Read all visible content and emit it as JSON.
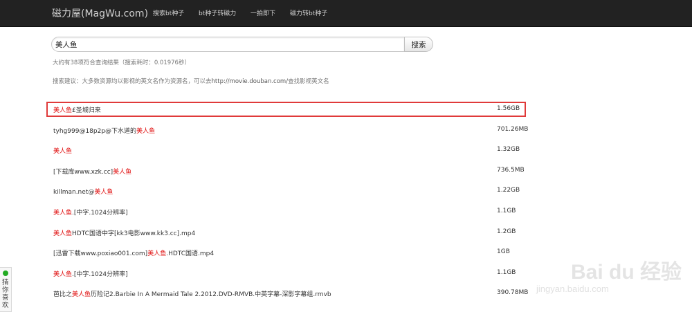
{
  "header": {
    "brand": "磁力屋(MagWu.com)",
    "nav": [
      {
        "label": "搜索bt种子"
      },
      {
        "label": "bt种子转磁力"
      },
      {
        "label": "一拍即下"
      },
      {
        "label": "磁力转bt种子"
      }
    ]
  },
  "search": {
    "query": "美人鱼",
    "button_label": "搜索"
  },
  "meta": {
    "result_count": "大约有38项符合查询结果（搜索耗时：0.01976秒）",
    "suggestion_prefix": "搜索建议：大多数资源均以影视的英文名作为资源名，可以去",
    "suggestion_link": "http://movie.douban.com/",
    "suggestion_suffix": "查找影视英文名"
  },
  "results": [
    {
      "pre": "",
      "kw": "美人鱼",
      "post": "£圣城归来",
      "size": "1.56GB",
      "highlighted": true
    },
    {
      "pre": "tyhg999@18p2p@下水道的",
      "kw": "美人鱼",
      "post": "",
      "size": "701.26MB"
    },
    {
      "pre": "",
      "kw": "美人鱼",
      "post": "",
      "size": "1.32GB"
    },
    {
      "pre": "[下载库www.xzk.cc]",
      "kw": "美人鱼",
      "post": "",
      "size": "736.5MB"
    },
    {
      "pre": "killman.net@",
      "kw": "美人鱼",
      "post": "",
      "size": "1.22GB"
    },
    {
      "pre": "",
      "kw": "美人鱼",
      "post": ".[中字.1024分辨率]",
      "size": "1.1GB"
    },
    {
      "pre": "",
      "kw": "美人鱼",
      "post": "HDTC国语中字[kk3电影www.kk3.cc].mp4",
      "size": "1.2GB"
    },
    {
      "pre": "[迅雷下载www.poxiao001.com]",
      "kw": "美人鱼",
      "post": ".HDTC国语.mp4",
      "size": "1GB"
    },
    {
      "pre": "",
      "kw": "美人鱼",
      "post": ".[中字.1024分辨率]",
      "size": "1.1GB"
    },
    {
      "pre": "芭比之",
      "kw": "美人鱼",
      "post": "历险记2.Barbie In A Mermaid Tale 2.2012.DVD-RMVB.中英字幕-深影字幕组.rmvb",
      "size": "390.78MB"
    }
  ],
  "side_widget": {
    "label": "猜你喜欢"
  },
  "watermark": {
    "brand": "Bai du 经验",
    "url": "jingyan.baidu.com"
  }
}
